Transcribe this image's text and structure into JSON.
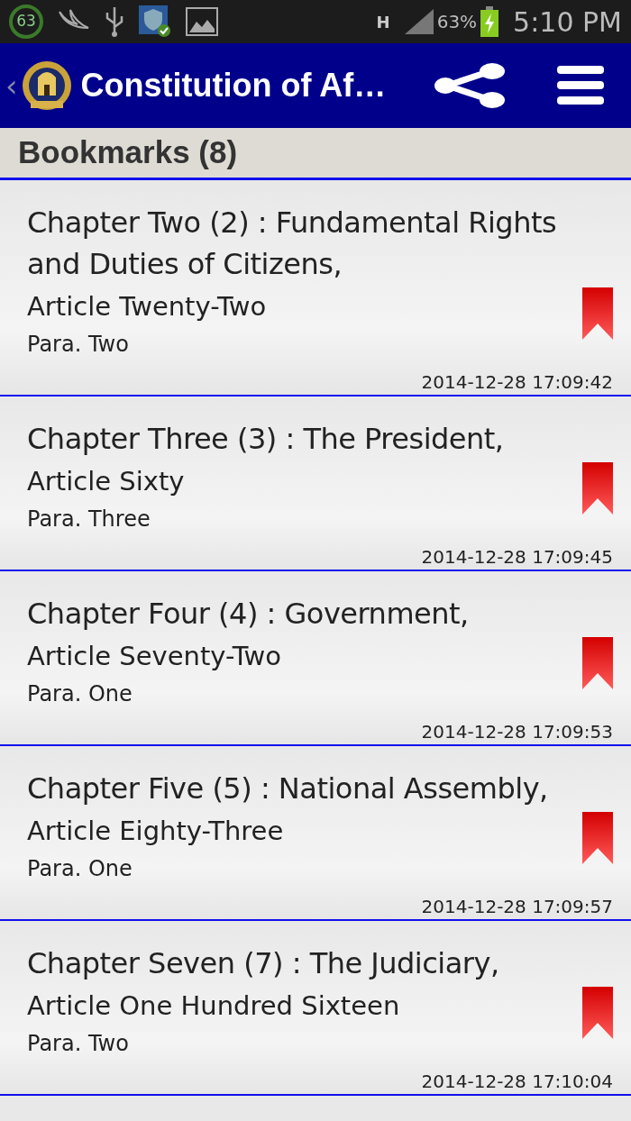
{
  "status_bar": {
    "badge": "63",
    "network": "H",
    "battery": "63%",
    "time": "5:10 PM"
  },
  "app_bar": {
    "back": "‹",
    "title": "Constitution of Af…"
  },
  "section": {
    "title": "Bookmarks (8)"
  },
  "bookmarks": [
    {
      "chapter": "Chapter Two (2) : Fundamental Rights and Duties of Citizens,",
      "article": "Article Twenty-Two",
      "para": "Para. Two",
      "date": "2014-12-28 17:09:42"
    },
    {
      "chapter": "Chapter Three (3) : The President,",
      "article": "Article Sixty",
      "para": "Para. Three",
      "date": "2014-12-28 17:09:45"
    },
    {
      "chapter": "Chapter Four (4) : Government,",
      "article": "Article Seventy-Two",
      "para": "Para. One",
      "date": "2014-12-28 17:09:53"
    },
    {
      "chapter": "Chapter Five (5) : National Assembly,",
      "article": "Article Eighty-Three",
      "para": "Para. One",
      "date": "2014-12-28 17:09:57"
    },
    {
      "chapter": "Chapter Seven (7) : The Judiciary,",
      "article": "Article One Hundred Sixteen",
      "para": "Para. Two",
      "date": "2014-12-28 17:10:04"
    }
  ]
}
